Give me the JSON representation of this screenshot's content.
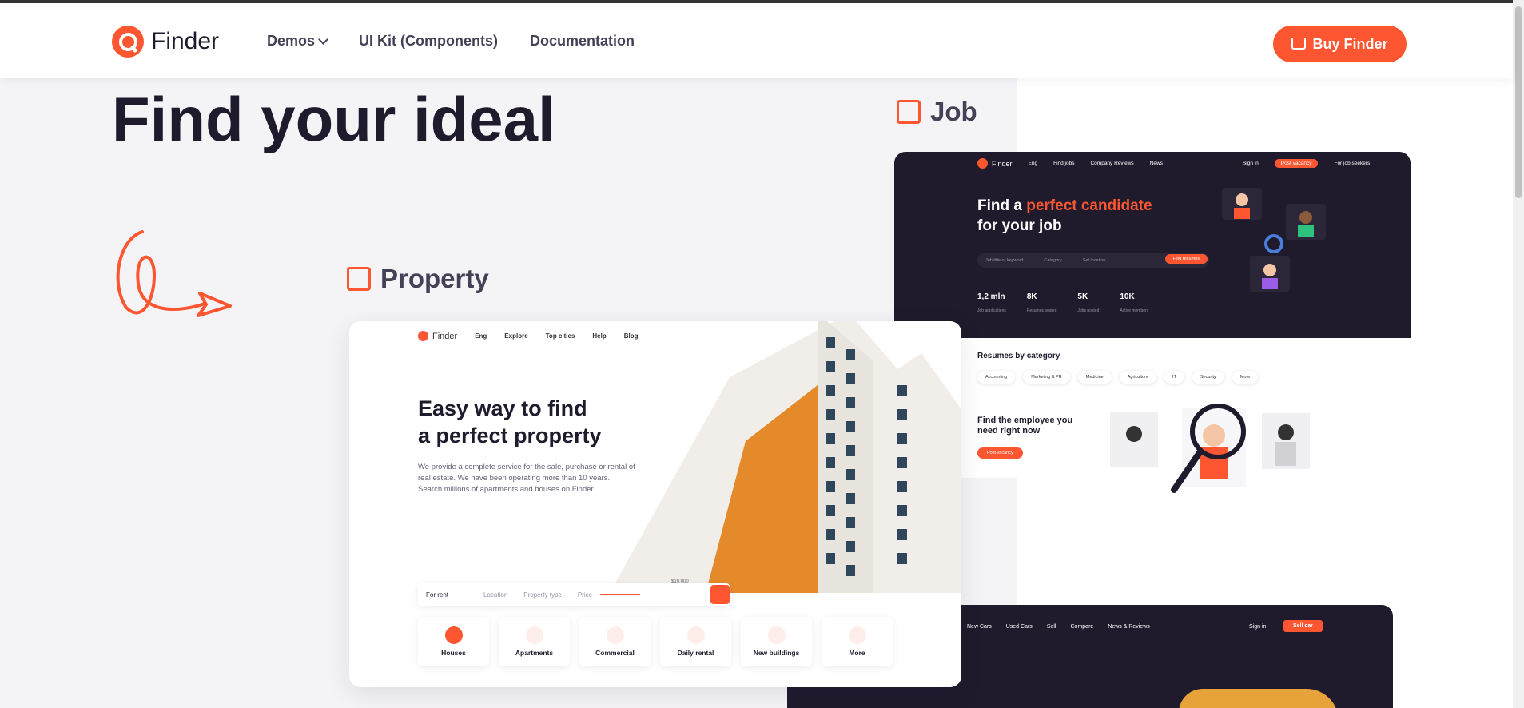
{
  "header": {
    "logo_text": "Finder",
    "nav": [
      {
        "label": "Demos"
      },
      {
        "label": "UI Kit (Components)"
      },
      {
        "label": "Documentation"
      }
    ],
    "buy_label": "Buy Finder"
  },
  "hero": {
    "title": "Find your ideal"
  },
  "categories": {
    "property": "Property",
    "job": "Job"
  },
  "property_demo": {
    "logo": "Finder",
    "lang": "Eng",
    "nav": [
      "Explore",
      "Top cities",
      "Help",
      "Blog"
    ],
    "title_line1": "Easy way to find",
    "title_line2": "a perfect property",
    "text": "We provide a complete service for the sale, purchase or rental of real estate. We have been operating more than 10 years. Search millions of apartments and houses on Finder.",
    "search": {
      "type": "For rent",
      "location": "Location",
      "property_type": "Property type",
      "price": "Price",
      "price_value": "$10,000"
    },
    "tiles": [
      "Houses",
      "Apartments",
      "Commercial",
      "Daily rental",
      "New buildings",
      "More"
    ]
  },
  "job_demo": {
    "logo": "Finder",
    "lang": "Eng",
    "nav": [
      "Find jobs",
      "Company Reviews",
      "News"
    ],
    "sign_in": "Sign in",
    "post_vacancy": "Post vacancy",
    "job_seekers": "For job seekers",
    "title_pre": "Find a ",
    "title_accent": "perfect candidate",
    "title_line2": "for your job",
    "search": {
      "keyword": "Job title or keyword",
      "category": "Category",
      "location": "Set location",
      "button": "Find resumes"
    },
    "stats": [
      {
        "value": "1,2 mln",
        "label": "Job applications"
      },
      {
        "value": "8K",
        "label": "Resumes posted"
      },
      {
        "value": "5K",
        "label": "Jobs posted"
      },
      {
        "value": "10K",
        "label": "Active members"
      }
    ],
    "resumes_title": "Resumes by category",
    "chips": [
      "Accounting",
      "Marketing & PR",
      "Medicine",
      "Agriculture",
      "IT",
      "Security",
      "More"
    ],
    "find_title_line1": "Find the employee you",
    "find_title_line2": "need right now",
    "find_button": "Post vacancy"
  },
  "car_demo": {
    "nav": [
      "New Cars",
      "Used Cars",
      "Sell",
      "Compare",
      "News & Reviews"
    ],
    "sign_in": "Sign in",
    "sell": "Sell car"
  },
  "colors": {
    "accent": "#fd5631",
    "dark": "#1f1b2d"
  }
}
